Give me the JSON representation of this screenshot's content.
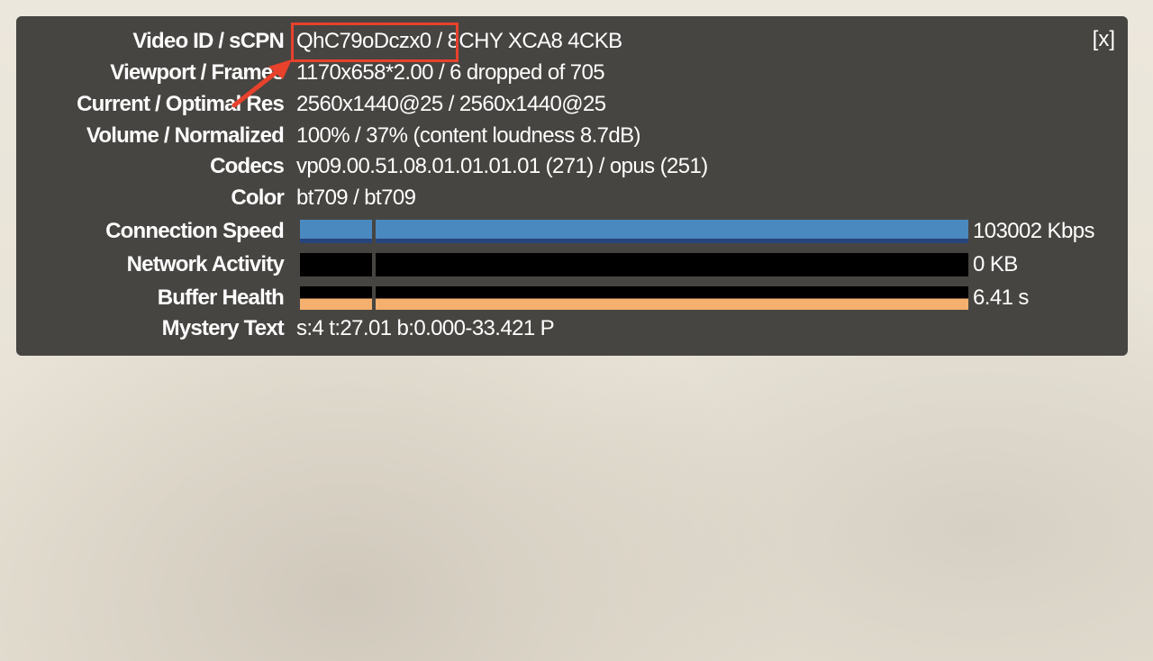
{
  "stats": {
    "close_label": "[x]",
    "rows": [
      {
        "label": "Video ID / sCPN",
        "value": "QhC79oDczx0 / 8CHY XCA8 4CKB"
      },
      {
        "label": "Viewport / Frames",
        "value": "1170x658*2.00 / 6 dropped of 705"
      },
      {
        "label": "Current / Optimal Res",
        "value": "2560x1440@25 / 2560x1440@25"
      },
      {
        "label": "Volume / Normalized",
        "value": "100% / 37% (content loudness 8.7dB)"
      },
      {
        "label": "Codecs",
        "value": "vp09.00.51.08.01.01.01.01 (271) / opus (251)"
      },
      {
        "label": "Color",
        "value": "bt709 / bt709"
      }
    ],
    "bars": [
      {
        "label": "Connection Speed",
        "value": "103002 Kbps",
        "color": "#4a89bf"
      },
      {
        "label": "Network Activity",
        "value": "0 KB",
        "color": "#000000"
      },
      {
        "label": "Buffer Health",
        "value": "6.41 s",
        "color": "#f4b06e"
      }
    ],
    "mystery": {
      "label": "Mystery Text",
      "value": "s:4 t:27.01 b:0.000-33.421 P"
    }
  },
  "annotation": {
    "highlight_color": "#e8412c"
  }
}
